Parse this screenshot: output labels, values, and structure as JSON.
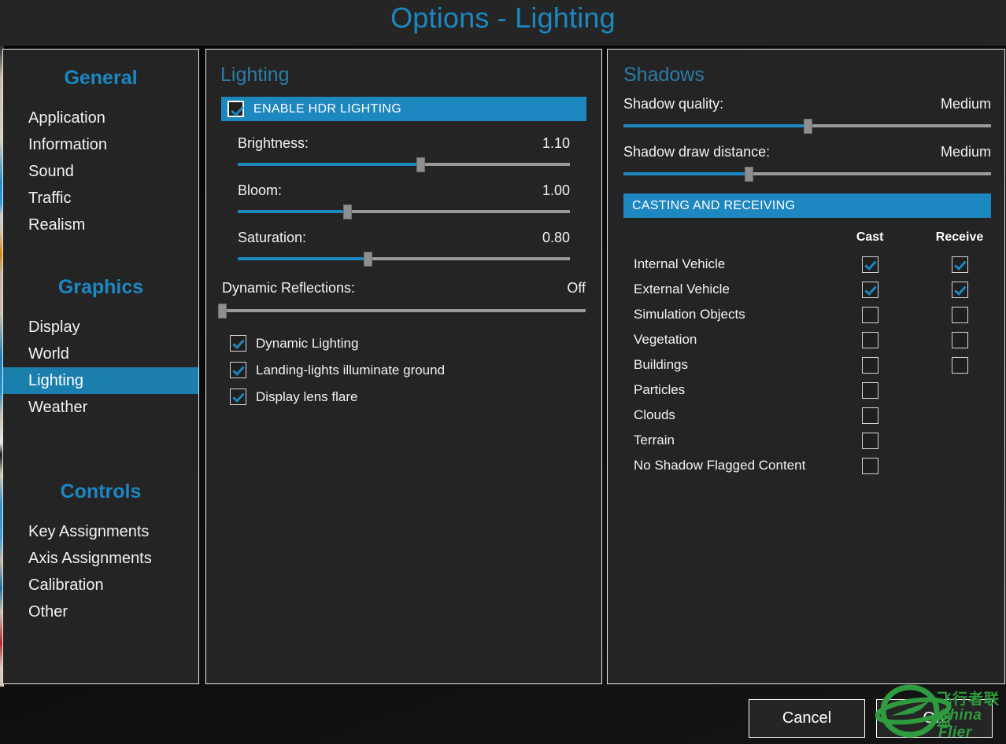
{
  "window": {
    "title": "Options - Lighting",
    "accent_blue": "#1d87bf",
    "selected_blue": "#1b7fae",
    "panel_bg": "#242424",
    "title_bg": "#252525"
  },
  "sidebar": {
    "groups": [
      {
        "title": "General",
        "items": [
          {
            "label": "Application",
            "selected": false
          },
          {
            "label": "Information",
            "selected": false
          },
          {
            "label": "Sound",
            "selected": false
          },
          {
            "label": "Traffic",
            "selected": false
          },
          {
            "label": "Realism",
            "selected": false
          }
        ]
      },
      {
        "title": "Graphics",
        "items": [
          {
            "label": "Display",
            "selected": false
          },
          {
            "label": "World",
            "selected": false
          },
          {
            "label": "Lighting",
            "selected": true
          },
          {
            "label": "Weather",
            "selected": false
          }
        ]
      },
      {
        "title": "Controls",
        "items": [
          {
            "label": "Key Assignments",
            "selected": false
          },
          {
            "label": "Axis Assignments",
            "selected": false
          },
          {
            "label": "Calibration",
            "selected": false
          },
          {
            "label": "Other",
            "selected": false
          }
        ]
      }
    ]
  },
  "lighting": {
    "heading": "Lighting",
    "hdr_banner": {
      "label": "ENABLE HDR LIGHTING",
      "checked": true
    },
    "sliders": [
      {
        "label": "Brightness:",
        "value": "1.10",
        "percent": 55
      },
      {
        "label": "Bloom:",
        "value": "1.00",
        "percent": 33
      },
      {
        "label": "Saturation:",
        "value": "0.80",
        "percent": 39
      }
    ],
    "reflections": {
      "label": "Dynamic Reflections:",
      "value": "Off",
      "percent": 0
    },
    "options": [
      {
        "label": "Dynamic Lighting",
        "checked": true
      },
      {
        "label": "Landing-lights illuminate ground",
        "checked": true
      },
      {
        "label": "Display lens flare",
        "checked": true
      }
    ]
  },
  "shadows": {
    "heading": "Shadows",
    "sliders": [
      {
        "label": "Shadow quality:",
        "value": "Medium",
        "percent": 50
      },
      {
        "label": "Shadow draw distance:",
        "value": "Medium",
        "percent": 34
      }
    ],
    "banner": "CASTING AND RECEIVING",
    "columns": {
      "cast": "Cast",
      "receive": "Receive"
    },
    "rows": [
      {
        "name": "Internal Vehicle",
        "cast": false,
        "cast_checked": true,
        "has_cast": true,
        "has_receive": true,
        "receive_checked": true
      },
      {
        "name": "External Vehicle",
        "cast": false,
        "cast_checked": true,
        "has_cast": true,
        "has_receive": true,
        "receive_checked": true
      },
      {
        "name": "Simulation Objects",
        "cast": false,
        "cast_checked": false,
        "has_cast": true,
        "has_receive": true,
        "receive_checked": false
      },
      {
        "name": "Vegetation",
        "cast": false,
        "cast_checked": false,
        "has_cast": true,
        "has_receive": true,
        "receive_checked": false
      },
      {
        "name": "Buildings",
        "cast": false,
        "cast_checked": false,
        "has_cast": true,
        "has_receive": true,
        "receive_checked": false
      },
      {
        "name": "Particles",
        "cast": false,
        "cast_checked": false,
        "has_cast": true,
        "has_receive": false,
        "receive_checked": false
      },
      {
        "name": "Clouds",
        "cast": false,
        "cast_checked": false,
        "has_cast": true,
        "has_receive": false,
        "receive_checked": false
      },
      {
        "name": "Terrain",
        "cast": false,
        "cast_checked": false,
        "has_cast": true,
        "has_receive": false,
        "receive_checked": false
      },
      {
        "name": "No Shadow Flagged Content",
        "cast": false,
        "cast_checked": false,
        "has_cast": true,
        "has_receive": false,
        "receive_checked": false
      }
    ]
  },
  "footer": {
    "cancel_label": "Cancel",
    "ok_label": "OK"
  },
  "watermark": {
    "chinese_text": "飞行者联盟",
    "english_text": "China Flier",
    "color": "#2f9b3f"
  }
}
